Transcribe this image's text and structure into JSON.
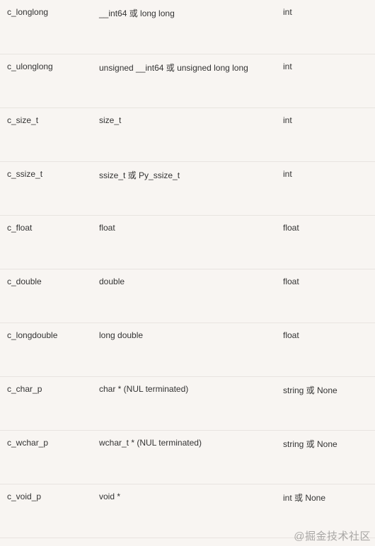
{
  "table": {
    "rows": [
      {
        "ctype": "c_longlong",
        "c_decl": "__int64 或 long long",
        "py": "int"
      },
      {
        "ctype": "c_ulonglong",
        "c_decl": "unsigned __int64 或 unsigned long long",
        "py": "int"
      },
      {
        "ctype": "c_size_t",
        "c_decl": "size_t",
        "py": "int"
      },
      {
        "ctype": "c_ssize_t",
        "c_decl": "ssize_t 或 Py_ssize_t",
        "py": "int"
      },
      {
        "ctype": "c_float",
        "c_decl": "float",
        "py": "float"
      },
      {
        "ctype": "c_double",
        "c_decl": "double",
        "py": "float"
      },
      {
        "ctype": "c_longdouble",
        "c_decl": "long double",
        "py": "float"
      },
      {
        "ctype": "c_char_p",
        "c_decl": "char * (NUL terminated)",
        "py": "string 或 None"
      },
      {
        "ctype": "c_wchar_p",
        "c_decl": "wchar_t * (NUL terminated)",
        "py": "string 或 None"
      },
      {
        "ctype": "c_void_p",
        "c_decl": "void *",
        "py": "int 或 None"
      }
    ]
  },
  "watermark": "@掘金技术社区"
}
